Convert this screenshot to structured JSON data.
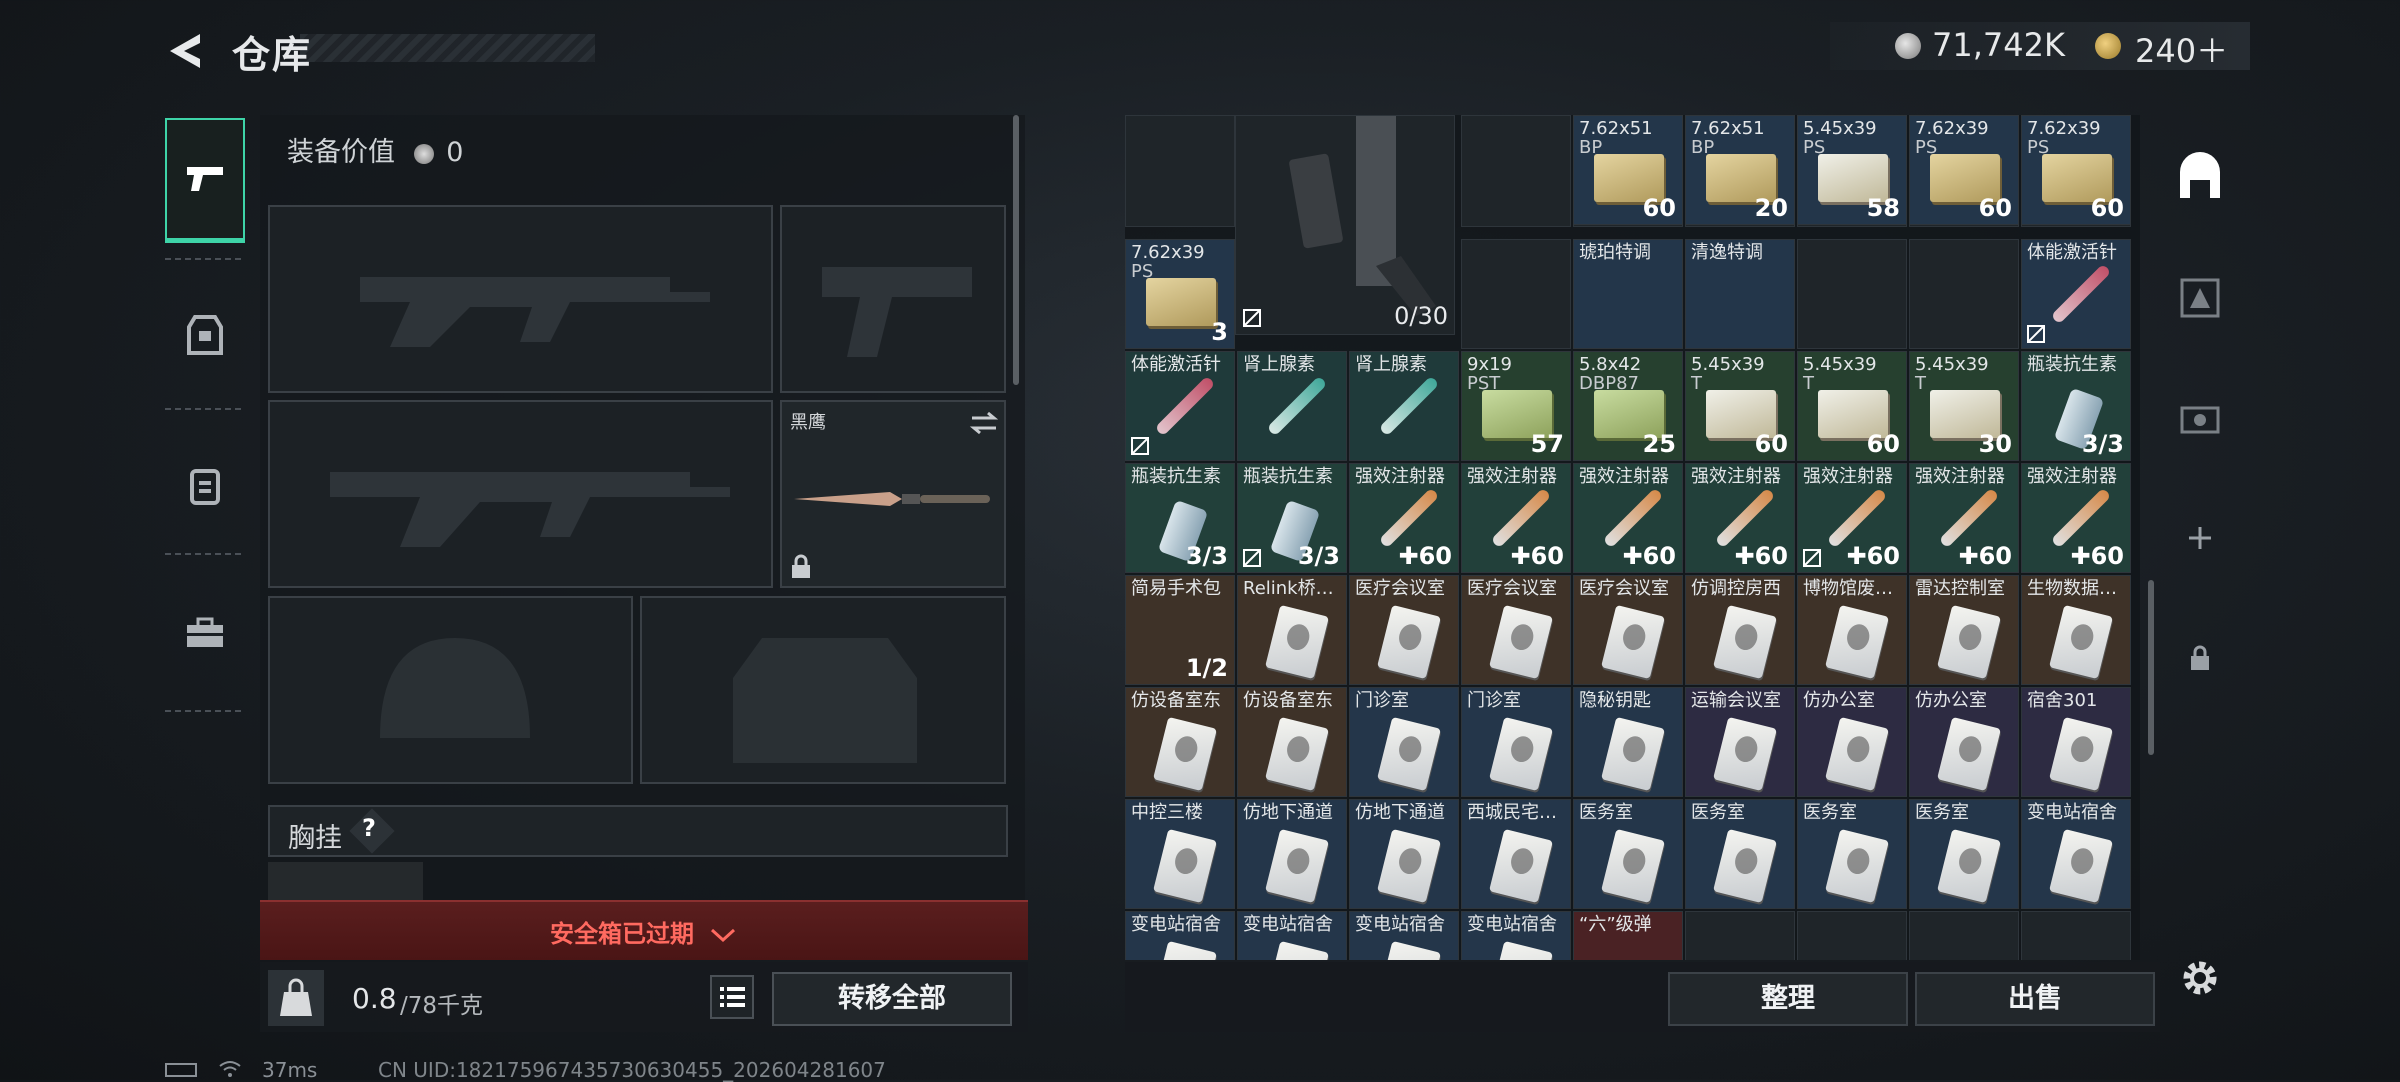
{
  "header": {
    "title": "仓库",
    "money": "71,742K",
    "premium": "240＋"
  },
  "equipment": {
    "value_label": "装备价值",
    "value": "0",
    "melee_name": "黑鹰",
    "chest_rig_label": "胸挂",
    "chest_rig_help": "?",
    "safe_box_text": "安全箱已过期",
    "weight_current": "0.8",
    "weight_max": "/78千克",
    "transfer_all": "转移全部"
  },
  "stash": {
    "rifle_count": "0/30",
    "sort_label": "整理",
    "sell_label": "出售",
    "items": [
      {
        "r": 0,
        "c": 4,
        "n": "7.62x51",
        "n2": "BP",
        "ct": "60",
        "k": "box",
        "bg": "ammo"
      },
      {
        "r": 0,
        "c": 5,
        "n": "7.62x51",
        "n2": "BP",
        "ct": "20",
        "k": "box",
        "bg": "ammo"
      },
      {
        "r": 0,
        "c": 6,
        "n": "5.45x39",
        "n2": "PS",
        "ct": "58",
        "k": "box s",
        "bg": "ammo"
      },
      {
        "r": 0,
        "c": 7,
        "n": "7.62x39",
        "n2": "PS",
        "ct": "60",
        "k": "box",
        "bg": "ammo"
      },
      {
        "r": 0,
        "c": 8,
        "n": "7.62x39",
        "n2": "PS",
        "ct": "60",
        "k": "box",
        "bg": "ammo"
      },
      {
        "r": 1,
        "c": 0,
        "n": "7.62x39",
        "n2": "PS",
        "ct": "3",
        "k": "box",
        "bg": "ammo"
      },
      {
        "r": 1,
        "c": 4,
        "n": "琥珀特调",
        "n2": "",
        "ct": "",
        "k": "",
        "bg": "ammo"
      },
      {
        "r": 1,
        "c": 5,
        "n": "清逸特调",
        "n2": "",
        "ct": "",
        "k": "",
        "bg": "ammo"
      },
      {
        "r": 1,
        "c": 8,
        "n": "体能激活针",
        "n2": "",
        "ct": "",
        "k": "syr pink",
        "bg": "ammo",
        "nt": true
      },
      {
        "r": 2,
        "c": 0,
        "n": "体能激活针",
        "n2": "",
        "ct": "",
        "k": "syr pink",
        "bg": "med",
        "nt": true
      },
      {
        "r": 2,
        "c": 1,
        "n": "肾上腺素",
        "n2": "",
        "ct": "",
        "k": "syr teal",
        "bg": "med"
      },
      {
        "r": 2,
        "c": 2,
        "n": "肾上腺素",
        "n2": "",
        "ct": "",
        "k": "syr teal",
        "bg": "med"
      },
      {
        "r": 2,
        "c": 3,
        "n": "9x19",
        "n2": "PST",
        "ct": "57",
        "k": "box g",
        "bg": "green"
      },
      {
        "r": 2,
        "c": 4,
        "n": "5.8x42",
        "n2": "DBP87",
        "ct": "25",
        "k": "box g",
        "bg": "green"
      },
      {
        "r": 2,
        "c": 5,
        "n": "5.45x39",
        "n2": "T",
        "ct": "60",
        "k": "box s",
        "bg": "green"
      },
      {
        "r": 2,
        "c": 6,
        "n": "5.45x39",
        "n2": "T",
        "ct": "60",
        "k": "box s",
        "bg": "green"
      },
      {
        "r": 2,
        "c": 7,
        "n": "5.45x39",
        "n2": "T",
        "ct": "30",
        "k": "box s",
        "bg": "green"
      },
      {
        "r": 2,
        "c": 8,
        "n": "瓶装抗生素",
        "n2": "",
        "ct": "3/3",
        "k": "bottle",
        "bg": "med2"
      },
      {
        "r": 3,
        "c": 0,
        "n": "瓶装抗生素",
        "n2": "",
        "ct": "3/3",
        "k": "bottle",
        "bg": "med2"
      },
      {
        "r": 3,
        "c": 1,
        "n": "瓶装抗生素",
        "n2": "",
        "ct": "3/3",
        "k": "bottle",
        "bg": "med2",
        "nt": true
      },
      {
        "r": 3,
        "c": 2,
        "n": "强效注射器",
        "n2": "",
        "ct": "✚60",
        "k": "syr or",
        "bg": "med2"
      },
      {
        "r": 3,
        "c": 3,
        "n": "强效注射器",
        "n2": "",
        "ct": "✚60",
        "k": "syr or",
        "bg": "med2"
      },
      {
        "r": 3,
        "c": 4,
        "n": "强效注射器",
        "n2": "",
        "ct": "✚60",
        "k": "syr or",
        "bg": "med2"
      },
      {
        "r": 3,
        "c": 5,
        "n": "强效注射器",
        "n2": "",
        "ct": "✚60",
        "k": "syr or",
        "bg": "med2"
      },
      {
        "r": 3,
        "c": 6,
        "n": "强效注射器",
        "n2": "",
        "ct": "✚60",
        "k": "syr or",
        "bg": "med2",
        "nt": true
      },
      {
        "r": 3,
        "c": 7,
        "n": "强效注射器",
        "n2": "",
        "ct": "✚60",
        "k": "syr or",
        "bg": "med2"
      },
      {
        "r": 3,
        "c": 8,
        "n": "强效注射器",
        "n2": "",
        "ct": "✚60",
        "k": "syr or",
        "bg": "med2"
      },
      {
        "r": 4,
        "c": 0,
        "n": "简易手术包",
        "n2": "",
        "ct": "1/2",
        "k": "",
        "bg": "brown"
      },
      {
        "r": 4,
        "c": 1,
        "n": "Relink桥…",
        "n2": "",
        "ct": "",
        "k": "card",
        "bg": "brown"
      },
      {
        "r": 4,
        "c": 2,
        "n": "医疗会议室",
        "n2": "",
        "ct": "",
        "k": "card",
        "bg": "brown"
      },
      {
        "r": 4,
        "c": 3,
        "n": "医疗会议室",
        "n2": "",
        "ct": "",
        "k": "card",
        "bg": "brown"
      },
      {
        "r": 4,
        "c": 4,
        "n": "医疗会议室",
        "n2": "",
        "ct": "",
        "k": "card",
        "bg": "brown"
      },
      {
        "r": 4,
        "c": 5,
        "n": "仿调控房西",
        "n2": "",
        "ct": "",
        "k": "card",
        "bg": "brown"
      },
      {
        "r": 4,
        "c": 6,
        "n": "博物馆废…",
        "n2": "",
        "ct": "",
        "k": "card",
        "bg": "brown"
      },
      {
        "r": 4,
        "c": 7,
        "n": "雷达控制室",
        "n2": "",
        "ct": "",
        "k": "card",
        "bg": "brown"
      },
      {
        "r": 4,
        "c": 8,
        "n": "生物数据…",
        "n2": "",
        "ct": "",
        "k": "card",
        "bg": "brown"
      },
      {
        "r": 5,
        "c": 0,
        "n": "仿设备室东",
        "n2": "",
        "ct": "",
        "k": "card",
        "bg": "brown"
      },
      {
        "r": 5,
        "c": 1,
        "n": "仿设备室东",
        "n2": "",
        "ct": "",
        "k": "card",
        "bg": "brown"
      },
      {
        "r": 5,
        "c": 2,
        "n": "门诊室",
        "n2": "",
        "ct": "",
        "k": "card",
        "bg": "blue"
      },
      {
        "r": 5,
        "c": 3,
        "n": "门诊室",
        "n2": "",
        "ct": "",
        "k": "card",
        "bg": "blue"
      },
      {
        "r": 5,
        "c": 4,
        "n": "隐秘钥匙",
        "n2": "",
        "ct": "",
        "k": "card",
        "bg": "blue"
      },
      {
        "r": 5,
        "c": 5,
        "n": "运输会议室",
        "n2": "",
        "ct": "",
        "k": "card",
        "bg": "purple"
      },
      {
        "r": 5,
        "c": 6,
        "n": "仿办公室",
        "n2": "",
        "ct": "",
        "k": "card",
        "bg": "purple"
      },
      {
        "r": 5,
        "c": 7,
        "n": "仿办公室",
        "n2": "",
        "ct": "",
        "k": "card",
        "bg": "purple"
      },
      {
        "r": 5,
        "c": 8,
        "n": "宿舍301",
        "n2": "",
        "ct": "",
        "k": "card",
        "bg": "purple"
      },
      {
        "r": 6,
        "c": 0,
        "n": "中控三楼",
        "n2": "",
        "ct": "",
        "k": "card",
        "bg": "blue"
      },
      {
        "r": 6,
        "c": 1,
        "n": "仿地下通道",
        "n2": "",
        "ct": "",
        "k": "card",
        "bg": "blue"
      },
      {
        "r": 6,
        "c": 2,
        "n": "仿地下通道",
        "n2": "",
        "ct": "",
        "k": "card",
        "bg": "blue"
      },
      {
        "r": 6,
        "c": 3,
        "n": "西城民宅…",
        "n2": "",
        "ct": "",
        "k": "card",
        "bg": "blue"
      },
      {
        "r": 6,
        "c": 4,
        "n": "医务室",
        "n2": "",
        "ct": "",
        "k": "card",
        "bg": "blue"
      },
      {
        "r": 6,
        "c": 5,
        "n": "医务室",
        "n2": "",
        "ct": "",
        "k": "card",
        "bg": "blue"
      },
      {
        "r": 6,
        "c": 6,
        "n": "医务室",
        "n2": "",
        "ct": "",
        "k": "card",
        "bg": "blue"
      },
      {
        "r": 6,
        "c": 7,
        "n": "医务室",
        "n2": "",
        "ct": "",
        "k": "card",
        "bg": "blue"
      },
      {
        "r": 6,
        "c": 8,
        "n": "变电站宿舍",
        "n2": "",
        "ct": "",
        "k": "card",
        "bg": "blue"
      },
      {
        "r": 7,
        "c": 0,
        "n": "变电站宿舍",
        "n2": "",
        "ct": "",
        "k": "card",
        "bg": "blue"
      },
      {
        "r": 7,
        "c": 1,
        "n": "变电站宿舍",
        "n2": "",
        "ct": "",
        "k": "card",
        "bg": "blue"
      },
      {
        "r": 7,
        "c": 2,
        "n": "变电站宿舍",
        "n2": "",
        "ct": "",
        "k": "card",
        "bg": "blue"
      },
      {
        "r": 7,
        "c": 3,
        "n": "变电站宿舍",
        "n2": "",
        "ct": "",
        "k": "card",
        "bg": "blue"
      },
      {
        "r": 7,
        "c": 4,
        "n": "“六”级弹",
        "n2": "",
        "ct": "",
        "k": "",
        "bg": "red"
      }
    ]
  },
  "status": {
    "ping": "37ms",
    "uid": "CN UID:18217596743573063045​5_202604281607"
  },
  "colors": {
    "accent": "#3ed4a8",
    "alert": "#ff6a60",
    "banner": "#5a1e1e"
  },
  "icons": [
    "back-arrow-icon",
    "weapon-tab-icon",
    "armor-tab-icon",
    "backpack-tab-icon",
    "toolbox-tab-icon",
    "stash-icon",
    "lock-icon",
    "settings-gear-icon",
    "list-icon",
    "swap-icon",
    "chevron-down-icon"
  ]
}
